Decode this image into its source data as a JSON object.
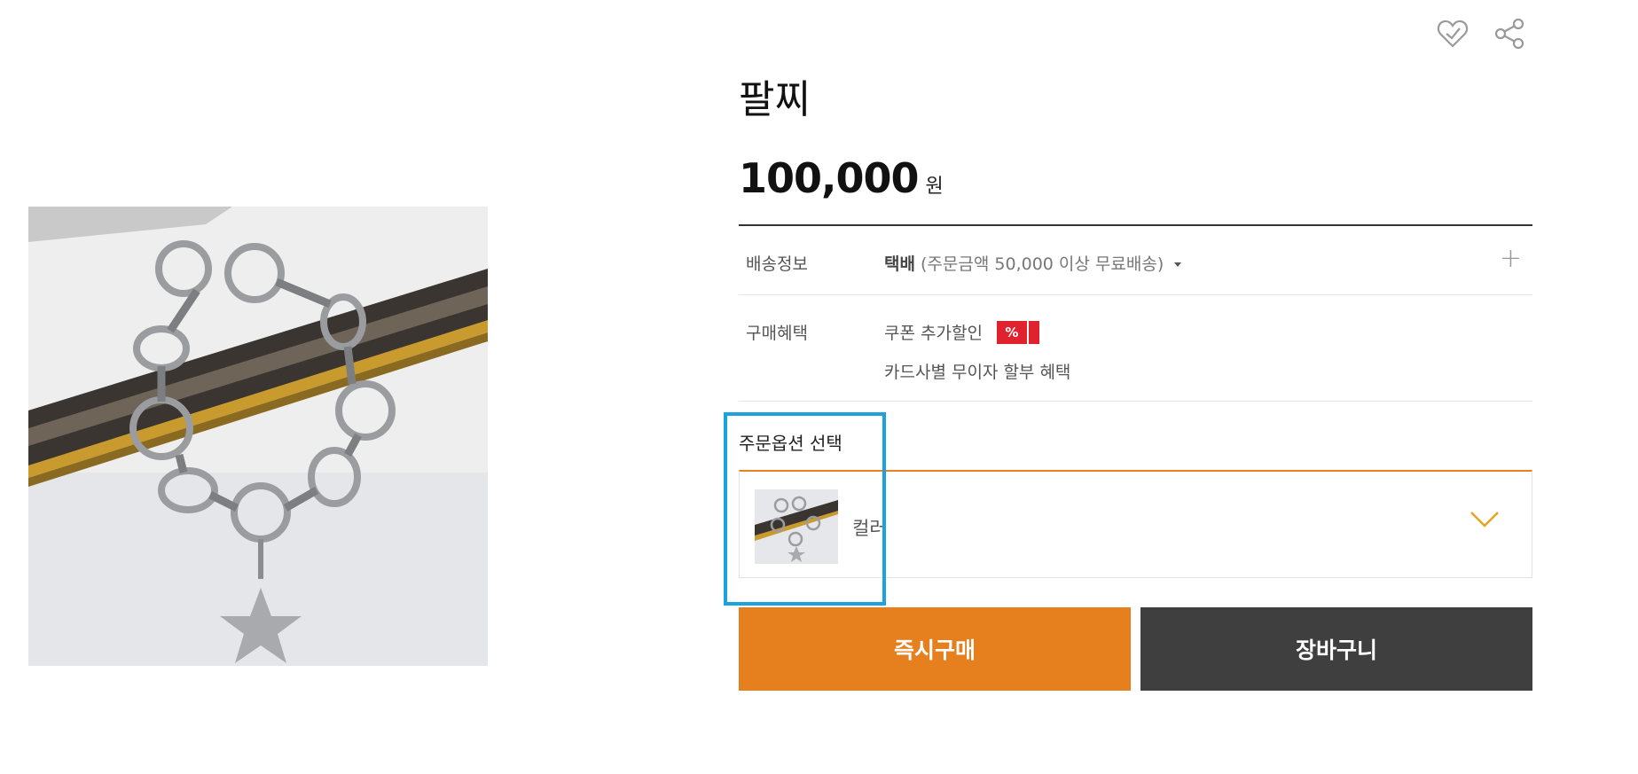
{
  "product": {
    "title": "팔찌",
    "price": "100,000",
    "currency": "원"
  },
  "shipping": {
    "label": "배송정보",
    "method": "택배",
    "condition": "(주문금액 50,000 이상 무료배송)"
  },
  "benefit": {
    "label": "구매혜택",
    "coupon": "쿠폰 추가할인",
    "badge": "%",
    "card": "카드사별 무이자 할부 혜택"
  },
  "options": {
    "title": "주문옵션 선택",
    "selected_label": "컬러"
  },
  "buttons": {
    "buy_now": "즉시구매",
    "cart": "장바구니"
  },
  "icons": [
    "wishlist-heart-icon",
    "share-icon",
    "plus-icon",
    "chevron-down-icon"
  ],
  "colors": {
    "accent_orange": "#e6801f",
    "dark_button": "#3f3f3f",
    "badge_red": "#e0212e",
    "highlight_blue": "#1aa3dd"
  }
}
